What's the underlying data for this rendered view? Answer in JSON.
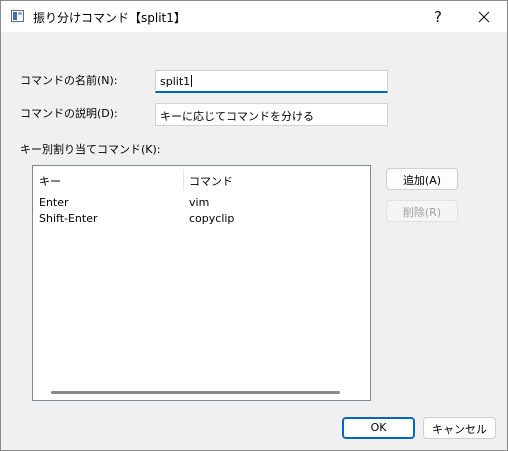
{
  "window": {
    "title": "振り分けコマンド【split1】",
    "help_glyph": "?",
    "icon": "app-window-icon"
  },
  "form": {
    "name_label": "コマンドの名前(N):",
    "name_value": "split1",
    "desc_label": "コマンドの説明(D):",
    "desc_value": "キーに応じてコマンドを分ける",
    "list_label": "キー別割り当てコマンド(K):"
  },
  "list": {
    "columns": [
      "キー",
      "コマンド"
    ],
    "rows": [
      {
        "key": "Enter",
        "command": "vim"
      },
      {
        "key": "Shift-Enter",
        "command": "copyclip"
      }
    ]
  },
  "buttons": {
    "add": "追加(A)",
    "delete": "削除(R)",
    "ok": "OK",
    "cancel": "キャンセル"
  }
}
